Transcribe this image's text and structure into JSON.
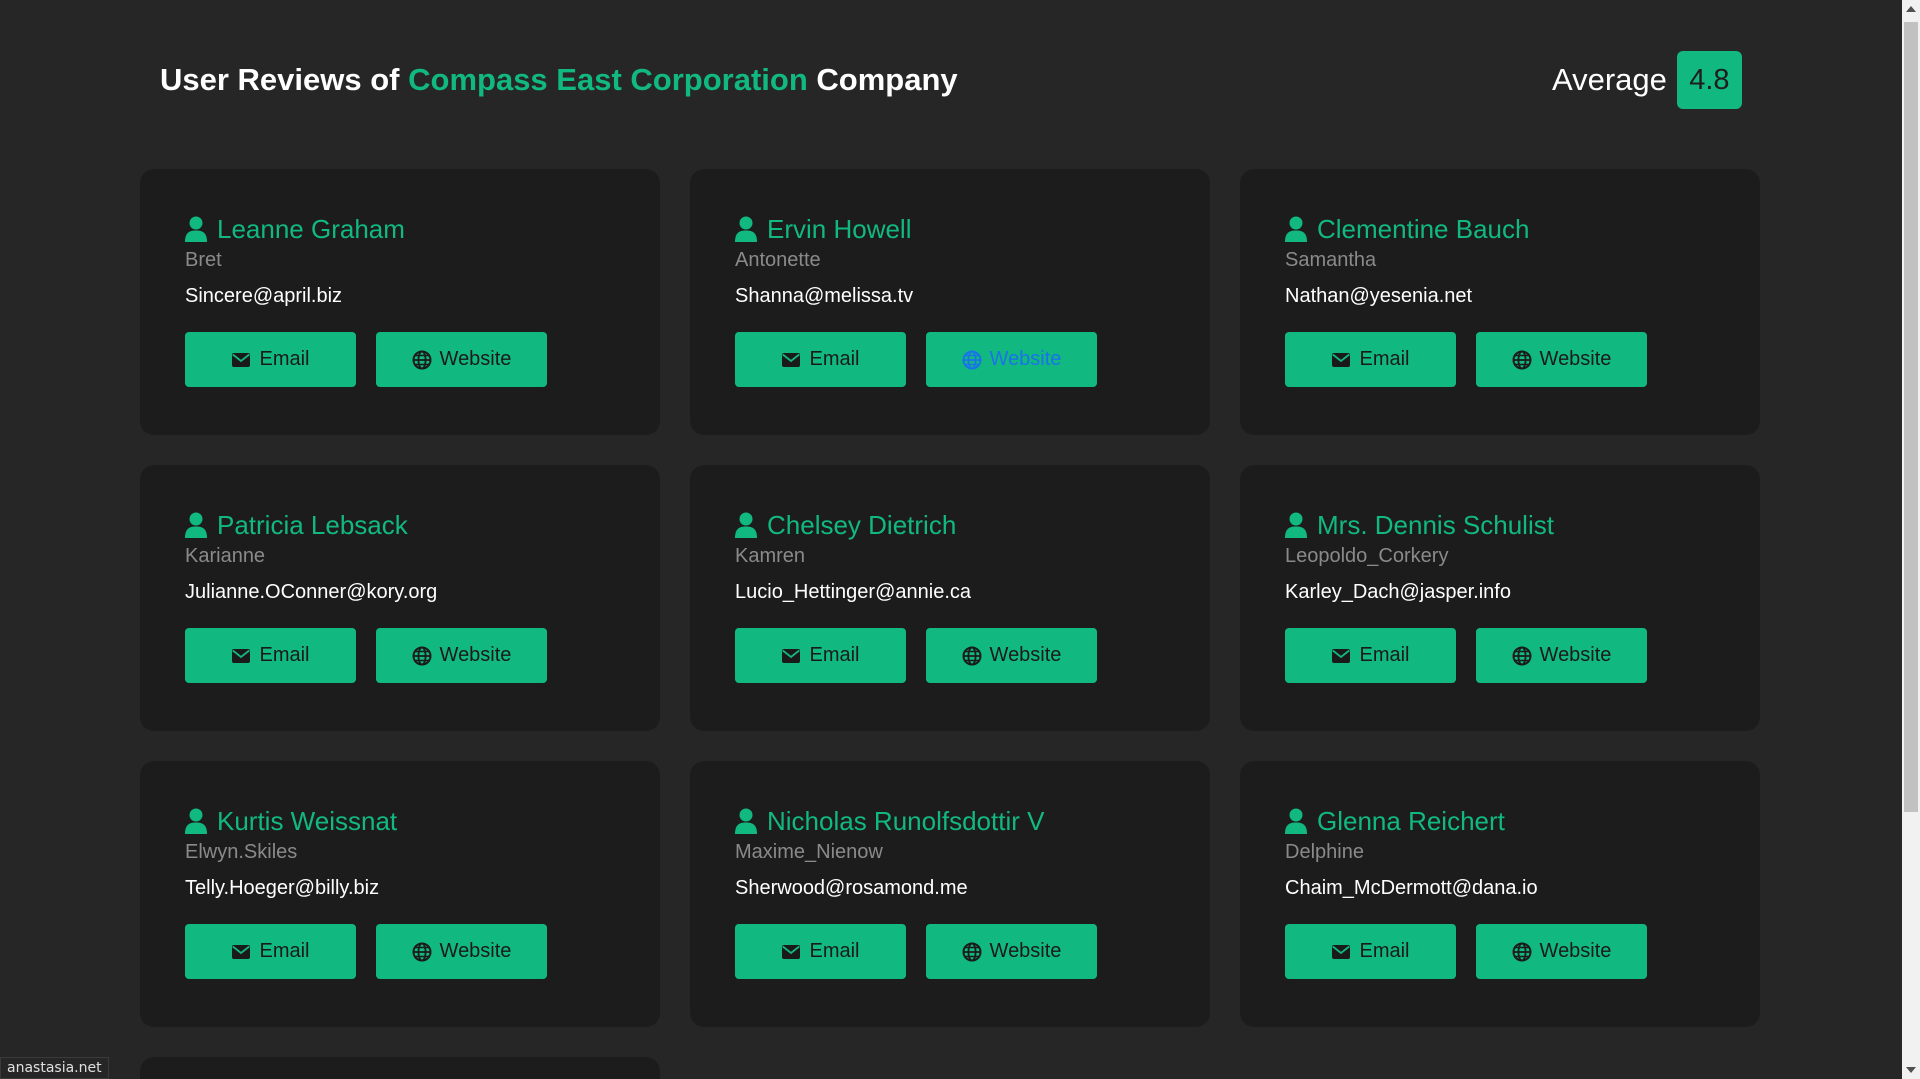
{
  "header": {
    "prefix": "User Reviews of",
    "company": "Compass East Corporation",
    "suffix": "Company",
    "average_label": "Average",
    "average_value": "4.8"
  },
  "buttons": {
    "email_label": "Email",
    "website_label": "Website"
  },
  "icons": {
    "user": "user-icon",
    "email": "envelope-icon",
    "website": "globe-icon"
  },
  "colors": {
    "accent": "#11b981",
    "background": "#262626",
    "card": "#1c1c1c",
    "hover_link": "#1a73e8"
  },
  "users": [
    {
      "name": "Leanne Graham",
      "username": "Bret",
      "email": "Sincere@april.biz"
    },
    {
      "name": "Ervin Howell",
      "username": "Antonette",
      "email": "Shanna@melissa.tv"
    },
    {
      "name": "Clementine Bauch",
      "username": "Samantha",
      "email": "Nathan@yesenia.net"
    },
    {
      "name": "Patricia Lebsack",
      "username": "Karianne",
      "email": "Julianne.OConner@kory.org"
    },
    {
      "name": "Chelsey Dietrich",
      "username": "Kamren",
      "email": "Lucio_Hettinger@annie.ca"
    },
    {
      "name": "Mrs. Dennis Schulist",
      "username": "Leopoldo_Corkery",
      "email": "Karley_Dach@jasper.info"
    },
    {
      "name": "Kurtis Weissnat",
      "username": "Elwyn.Skiles",
      "email": "Telly.Hoeger@billy.biz"
    },
    {
      "name": "Nicholas Runolfsdottir V",
      "username": "Maxime_Nienow",
      "email": "Sherwood@rosamond.me"
    },
    {
      "name": "Glenna Reichert",
      "username": "Delphine",
      "email": "Chaim_McDermott@dana.io"
    }
  ],
  "status_bar": {
    "url": "anastasia.net"
  }
}
